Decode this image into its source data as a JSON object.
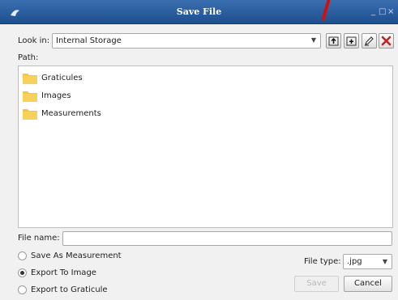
{
  "window": {
    "title": "Save File",
    "app_icon": "fish-app-icon",
    "controls": {
      "minimize": "_",
      "maximize": "□",
      "close": "×"
    }
  },
  "look_in": {
    "label": "Look in:",
    "value": "Internal Storage"
  },
  "toolbar": {
    "icons": [
      "up-folder-icon",
      "new-folder-icon",
      "rename-pencil-icon",
      "delete-x-icon"
    ]
  },
  "path": {
    "label": "Path:"
  },
  "folders": [
    {
      "name": "Graticules"
    },
    {
      "name": "Images"
    },
    {
      "name": "Measurements"
    }
  ],
  "file_name": {
    "label": "File name:",
    "value": ""
  },
  "options": [
    {
      "label": "Save As Measurement",
      "selected": false
    },
    {
      "label": "Export To Image",
      "selected": true
    },
    {
      "label": "Export to Graticule",
      "selected": false
    }
  ],
  "file_type": {
    "label": "File type:",
    "value": ".jpg"
  },
  "buttons": {
    "save": "Save",
    "cancel": "Cancel"
  },
  "colors": {
    "titlebar": "#2b5d9e",
    "folder": "#f5c542",
    "delete": "#c8201a"
  }
}
